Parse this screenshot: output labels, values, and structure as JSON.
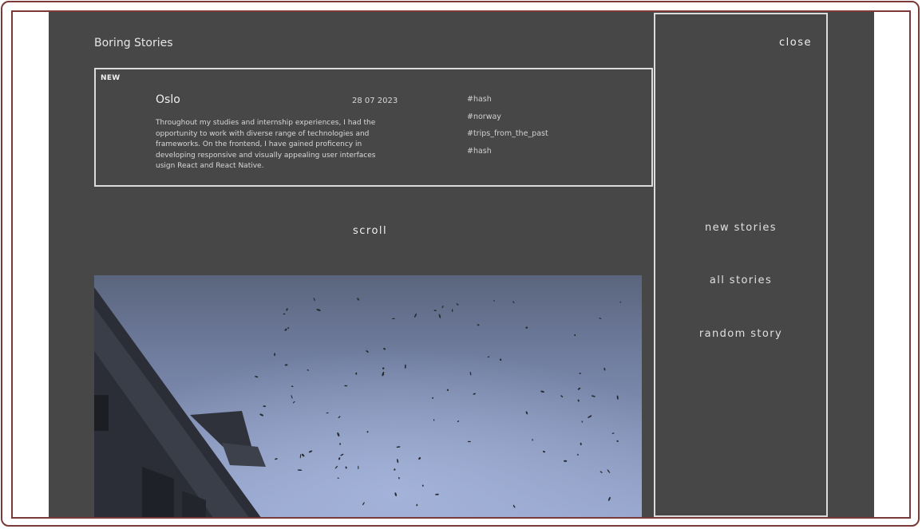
{
  "site": {
    "title": "Boring Stories"
  },
  "story": {
    "badge": "NEW",
    "city": "Oslo",
    "date": "28 07 2023",
    "body": "Throughout my studies and internship experiences, I had the opportunity to work with diverse range of technologies and frameworks. On the frontend, I have gained proficency in developing responsive and visually appealing user interfaces usign React and React Native.",
    "tags": [
      "#hash",
      "#norway",
      "#trips_from_the_past",
      "#hash"
    ]
  },
  "scroll": {
    "label": "scroll"
  },
  "photo": {
    "subject": "building-and-birds-photo"
  },
  "menu": {
    "close_label": "close",
    "items": [
      "new stories",
      "all stories",
      "random story"
    ]
  },
  "colors": {
    "background": "#474747",
    "border": "#dcdcdc",
    "frame": "#7a3a3a",
    "text": "#f0f0f0"
  }
}
